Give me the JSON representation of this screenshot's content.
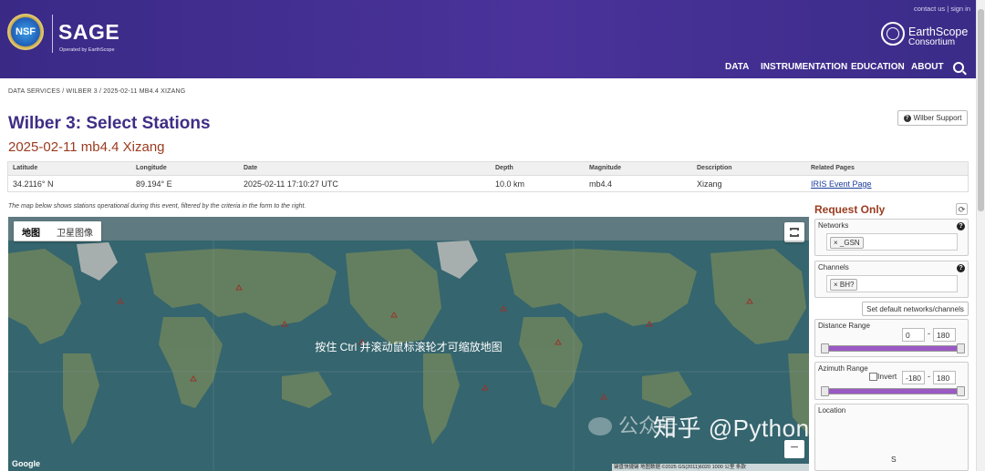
{
  "header": {
    "nsf_logo_text": "NSF",
    "sage_title": "SAGE",
    "sage_subtitle": "Operated by EarthScope",
    "top_links": [
      "contact us",
      "sign in"
    ],
    "top_links_separator": "|",
    "earthscope_name": "EarthScope",
    "earthscope_sub": "Consortium",
    "nav": [
      "DATA",
      "INSTRUMENTATION",
      "EDUCATION",
      "ABOUT"
    ]
  },
  "breadcrumb": [
    "DATA SERVICES",
    "WILBER 3",
    "2025-02-11 MB4.4 XIZANG"
  ],
  "breadcrumb_separator": "/",
  "page_title": "Wilber 3: Select Stations",
  "event_title": "2025-02-11 mb4.4 Xizang",
  "support_button": "Wilber Support",
  "event_table": {
    "headers": [
      "Latitude",
      "Longitude",
      "Date",
      "Depth",
      "Magnitude",
      "Description",
      "Related Pages"
    ],
    "values": [
      "34.2116° N",
      "89.194° E",
      "2025-02-11 17:10:27 UTC",
      "10.0 km",
      "mb4.4",
      "Xizang",
      "IRIS Event Page"
    ]
  },
  "map_note": "The map below shows stations operational during this event, filtered by the criteria in the form to the right.",
  "map": {
    "tabs": [
      "地图",
      "卫星图像"
    ],
    "active_tab": "地图",
    "hint": "按住 Ctrl 并滚动鼠标滚轮才可缩放地图",
    "zoom_out": "−",
    "google_logo": "Google",
    "attribution": "键盘快捷键  地图数据 ©2025 GS(2011)6020  1000 公里  条款"
  },
  "watermark": "知乎 @Python卡皮巴拉",
  "wechat_watermark": "公众号",
  "panel": {
    "title": "Request Only",
    "refresh_icon": "⟳",
    "networks_label": "Networks",
    "networks_tag": "× _GSN",
    "channels_label": "Channels",
    "channels_tag": "× BH?",
    "default_button": "Set default networks/channels",
    "distance_label": "Distance Range",
    "distance_min": "0",
    "distance_max": "180",
    "azimuth_label": "Azimuth Range",
    "invert_label": "Invert",
    "azimuth_min": "-180",
    "azimuth_max": "180",
    "location_label": "Location",
    "location_s": "S",
    "range_dash": "-"
  },
  "colors": {
    "header_purple": "#3a2a86",
    "title_purple": "#3f2d86",
    "event_red": "#9b3b1f",
    "slider_purple": "#9b59c4"
  }
}
